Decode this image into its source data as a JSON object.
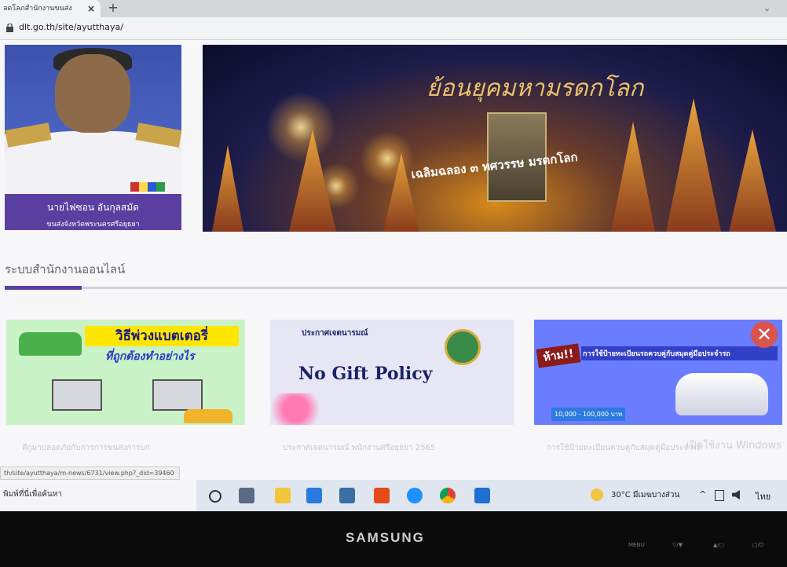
{
  "browser": {
    "tab_title": "ลดโลภสำนักงานขนส่ง",
    "tab_close": "×",
    "new_tab": "+",
    "tab_menu": "⌄",
    "url": "dlt.go.th/site/ayutthaya/"
  },
  "profile": {
    "name": "นายไฟซอน อันกุลสมัด",
    "title": "ขนส่งจังหวัดพระนครศรีอยุธยา"
  },
  "banner": {
    "title": "ย้อนยุคมหามรดกโลก",
    "subtitle": "เฉลิมฉลอง ๓ ทศวรรษ มรดกโลก"
  },
  "section": {
    "title": "ระบบสำนักงานออนไลน์"
  },
  "cards": [
    {
      "heading": "วิธีพ่วงแบตเตอรี่",
      "subheading": "ที่ถูกต้องทำอย่างไร",
      "caption": "ดีกูมาปลอดภัยกับการการขนส่งการบก"
    },
    {
      "heading": "ประกาศเจตนารมณ์",
      "badge": "No Gift Policy",
      "caption": "ประกาศเจตนารมณ์ พนักงานศรีอยุธยา 2565"
    },
    {
      "heading": "ห้าม!!",
      "subheading": "การใช้ป้ายทะเบียนรถควบคู่กับสมุดคู่มือประจำรถ",
      "amount": "10,000 - 100,000 บาท",
      "caption": "การใช้ป้ายทะเบียนควบคู่กับสมุดคู่มือประจำรถ"
    }
  ],
  "status_bar": {
    "url": "th/site/ayutthaya/m-news/6731/view.php?_did=39460"
  },
  "watermark": "เปิดใช้งาน Windows",
  "taskbar": {
    "search_placeholder": "พิมพ์ที่นี่เพื่อค้นหา",
    "weather": "30°C  มีเมฆบางส่วน",
    "language": "ไทย",
    "chevron": "^"
  },
  "monitor": {
    "brand": "SAMSUNG",
    "buttons": [
      "MENU",
      "▽/▼",
      "▲/○",
      "□/⏻"
    ]
  },
  "colors": {
    "accent": "#5a3fa0",
    "taskbar": "#dfe6f0"
  }
}
